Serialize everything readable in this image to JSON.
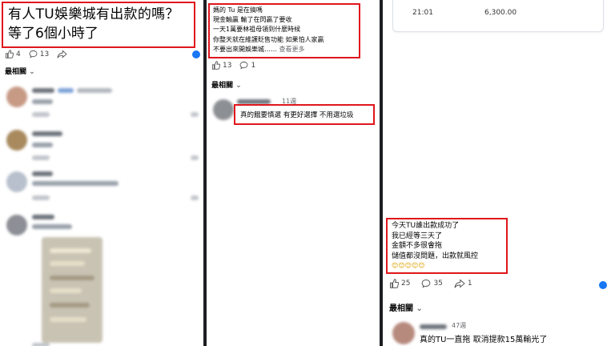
{
  "p1": {
    "post_text": [
      "有人TU娛樂城有出款的嗎？",
      "等了6個小時了"
    ],
    "likes": "4",
    "comments": "13",
    "section": "最相關"
  },
  "p2": {
    "post_lines": [
      "媽的 Tu 是在搞嗎",
      "現金輸贏 輸了在閃贏了要收",
      "一天1萬要林祖母領到什麼時候",
      "你整天就在維護貶售功能 如果怕人家贏",
      "不要出來開娛樂城……"
    ],
    "see_more": "查看更多",
    "likes": "13",
    "comments": "1",
    "section": "最相關",
    "comment_time": "11週",
    "comment_text": "真的餓要慎選 有更好選擇 不用選垃圾"
  },
  "p3": {
    "tx_time": "21:01",
    "tx_amount": "6,300.00",
    "post_lines": [
      "今天TU誰出款成功了",
      "我已經等三天了",
      "金額不多很會拖",
      "儲值都沒問題，出款就風控"
    ],
    "emojis": "😊😊😊😊😊",
    "likes": "25",
    "comments": "35",
    "shares": "1",
    "section": "最相關",
    "comment_time": "47週",
    "comment_text": "真的TU一直拖 取消提款15萬輸光了"
  },
  "colors": {
    "highlight": "#e0161c",
    "brand": "#1877f2",
    "divider": "#1c1e21"
  }
}
